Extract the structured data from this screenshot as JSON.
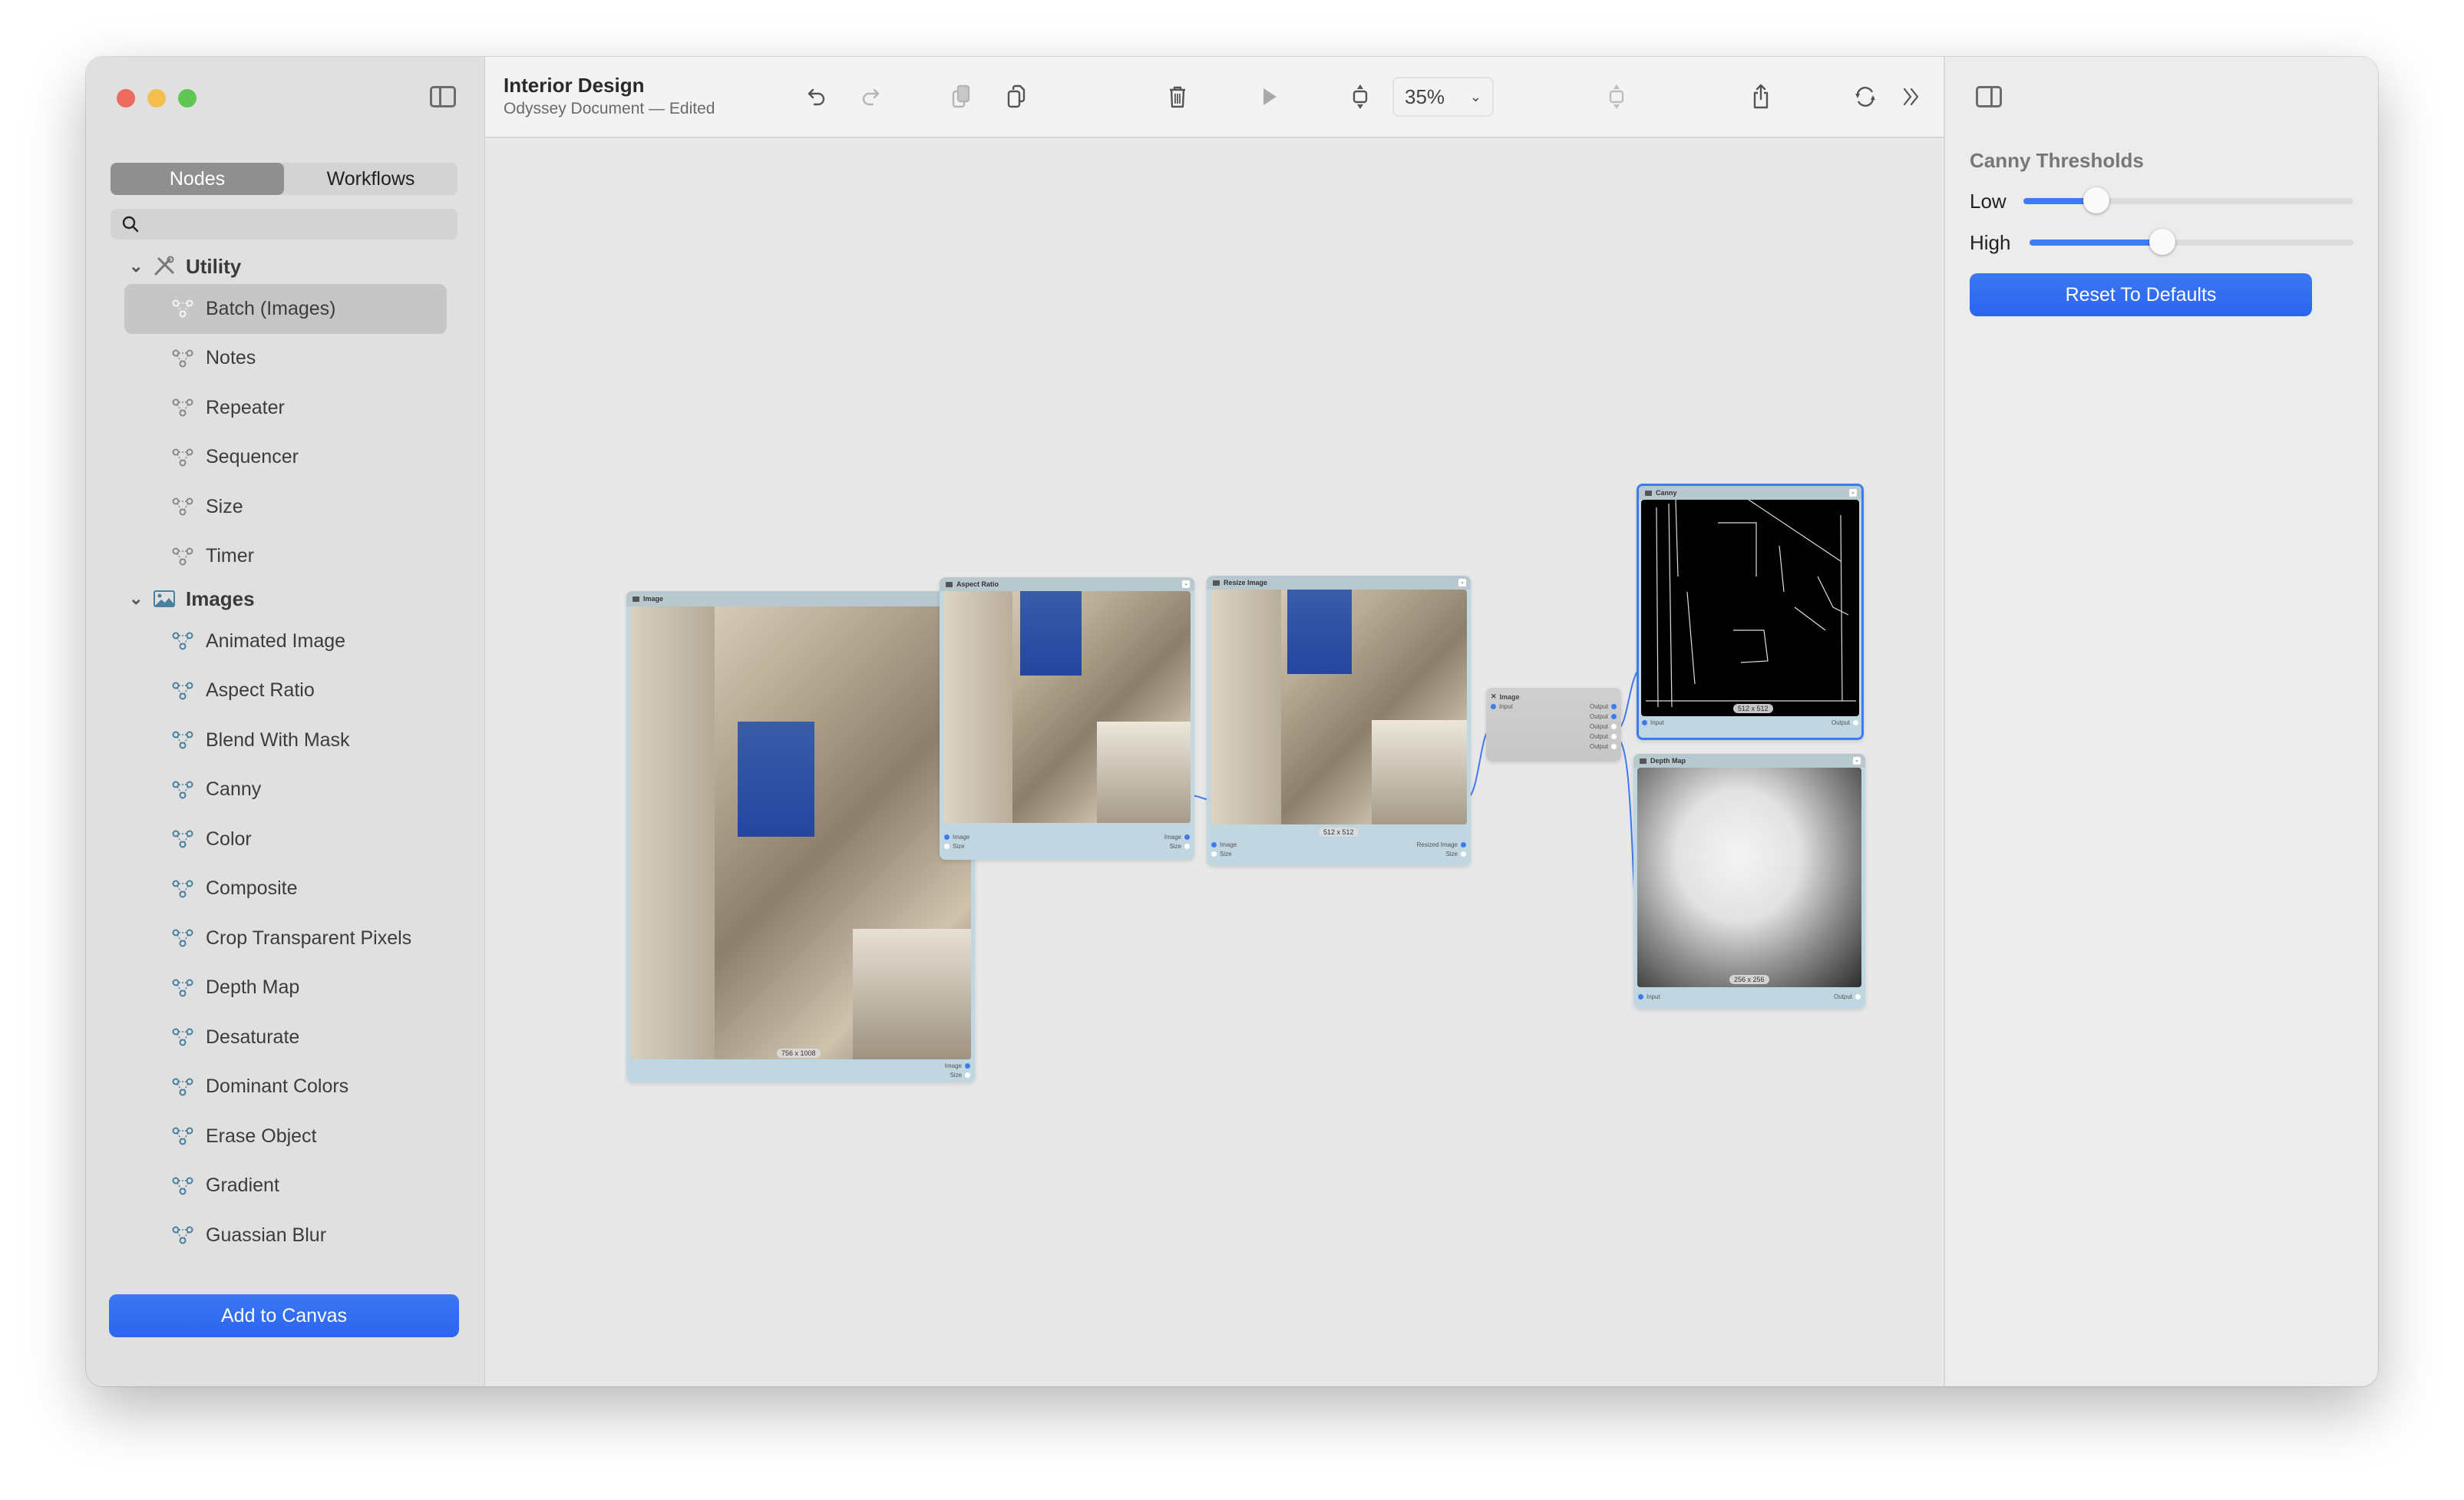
{
  "window": {
    "title": "Interior Design",
    "subtitle": "Odyssey Document — Edited"
  },
  "sidebar": {
    "tabs": [
      {
        "label": "Nodes",
        "active": true
      },
      {
        "label": "Workflows",
        "active": false
      }
    ],
    "search": {
      "placeholder": "",
      "value": ""
    },
    "groups": [
      {
        "label": "Utility",
        "icon": "tools-icon",
        "expanded": true,
        "items": [
          {
            "label": "Batch (Images)",
            "selected": true
          },
          {
            "label": "Notes"
          },
          {
            "label": "Repeater"
          },
          {
            "label": "Sequencer"
          },
          {
            "label": "Size"
          },
          {
            "label": "Timer"
          }
        ]
      },
      {
        "label": "Images",
        "icon": "photo-icon",
        "expanded": true,
        "items": [
          {
            "label": "Animated Image"
          },
          {
            "label": "Aspect Ratio"
          },
          {
            "label": "Blend With Mask"
          },
          {
            "label": "Canny"
          },
          {
            "label": "Color"
          },
          {
            "label": "Composite"
          },
          {
            "label": "Crop Transparent Pixels"
          },
          {
            "label": "Depth Map"
          },
          {
            "label": "Desaturate"
          },
          {
            "label": "Dominant Colors"
          },
          {
            "label": "Erase Object"
          },
          {
            "label": "Gradient"
          },
          {
            "label": "Guassian Blur"
          }
        ]
      }
    ],
    "add_button": "Add to Canvas"
  },
  "toolbar": {
    "undo": "undo-icon",
    "redo": "redo-icon",
    "copy": "copy-icon",
    "paste": "paste-icon",
    "delete": "trash-icon",
    "run": "play-icon",
    "fit": "fit-height-icon",
    "zoom": "35%",
    "align": "align-icon",
    "share": "share-icon",
    "refresh": "refresh-icon",
    "more": "chevrons-right-icon"
  },
  "canvas": {
    "nodes": [
      {
        "id": "image",
        "title": "Image",
        "dimensions": "756 x 1008",
        "outputs": [
          {
            "label": "Image",
            "connected": true
          },
          {
            "label": "Size",
            "connected": false
          }
        ]
      },
      {
        "id": "aspect",
        "title": "Aspect Ratio",
        "inputs": [
          {
            "label": "Image",
            "connected": true
          },
          {
            "label": "Size",
            "connected": false
          }
        ],
        "outputs": [
          {
            "label": "Image",
            "connected": true
          },
          {
            "label": "Size",
            "connected": false
          }
        ]
      },
      {
        "id": "resize",
        "title": "Resize Image",
        "dimensions": "512 x 512",
        "inputs": [
          {
            "label": "Image",
            "connected": true
          },
          {
            "label": "Size",
            "connected": false
          }
        ],
        "outputs": [
          {
            "label": "Resized Image",
            "connected": true
          },
          {
            "label": "Size",
            "connected": false
          }
        ]
      },
      {
        "id": "batch",
        "title": "Image",
        "inputs": [
          {
            "label": "Input",
            "connected": true
          }
        ],
        "outputs": [
          {
            "label": "Output",
            "connected": true
          },
          {
            "label": "Output",
            "connected": true
          },
          {
            "label": "Output",
            "connected": false
          },
          {
            "label": "Output",
            "connected": false
          },
          {
            "label": "Output",
            "connected": false
          }
        ]
      },
      {
        "id": "canny",
        "title": "Canny",
        "dimensions": "512 x 512",
        "inputs": [
          {
            "label": "Input",
            "connected": true
          }
        ],
        "outputs": [
          {
            "label": "Output",
            "connected": false
          }
        ]
      },
      {
        "id": "depth",
        "title": "Depth Map",
        "dimensions": "256 x 256",
        "inputs": [
          {
            "label": "Input",
            "connected": true
          }
        ],
        "outputs": [
          {
            "label": "Output",
            "connected": false
          }
        ]
      }
    ]
  },
  "inspector": {
    "title": "Canny Thresholds",
    "sliders": [
      {
        "label": "Low",
        "value": 0.22
      },
      {
        "label": "High",
        "value": 0.41
      }
    ],
    "reset_button": "Reset To Defaults"
  },
  "colors": {
    "accent": "#3d7bf0",
    "node_body": "#c0d6e0",
    "node_header": "#b7c8cf"
  }
}
